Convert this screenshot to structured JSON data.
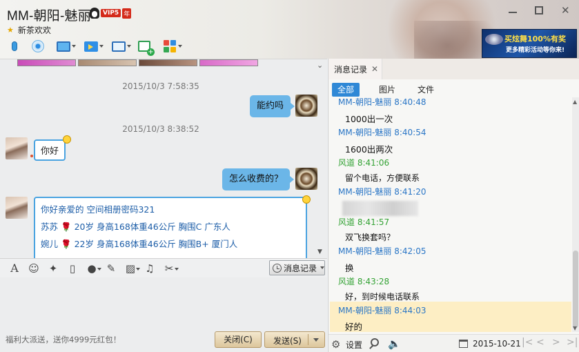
{
  "window": {
    "title": "MM-朝阳-魅丽",
    "vip_label": "VIP5",
    "vip_year_label": "年",
    "signature": "新茶欢欢"
  },
  "ad": {
    "line1": "买炫舞100%有奖",
    "line2": "更多精彩活动等你来!"
  },
  "toolbar_icons": [
    "microphone-icon",
    "video-call-icon",
    "screen-share-icon",
    "file-transfer-icon",
    "remote-assist-icon",
    "add-note-icon",
    "apps-icon"
  ],
  "chat": {
    "messages": [
      {
        "type": "time",
        "text": "2015/10/3 7:58:35"
      },
      {
        "type": "self",
        "text": "能约吗"
      },
      {
        "type": "time",
        "text": "2015/10/3 8:38:52"
      },
      {
        "type": "other",
        "text": "你好"
      },
      {
        "type": "self",
        "text": "怎么收费的？"
      }
    ],
    "long_message": {
      "line1": "你好亲爱的  空间相册密码321",
      "line2_name": "苏苏",
      "line2_rest": "20岁 身高168体重46公斤 胸围C  广东人",
      "line3_name": "婉儿",
      "line3_rest": "22岁 身高168体重46公斤 胸围B+  厦门人"
    }
  },
  "input_toolbar": {
    "history_button": "消息记录"
  },
  "bottom": {
    "promo": "福利大派送，送你4999元红包！",
    "close_button": "关闭(C)",
    "send_button": "发送(S)"
  },
  "history": {
    "tab_label": "消息记录",
    "filters": [
      "全部",
      "图片",
      "文件"
    ],
    "records": [
      {
        "who": "MM-朝阳-魅丽",
        "time": "8:40:48",
        "self": false
      },
      {
        "text": "1000出一次"
      },
      {
        "who": "MM-朝阳-魅丽",
        "time": "8:40:54",
        "self": false
      },
      {
        "text": "1600出两次"
      },
      {
        "who": "风道",
        "time": "8:41:06",
        "self": true
      },
      {
        "text": "留个电话，方便联系"
      },
      {
        "who": "MM-朝阳-魅丽",
        "time": "8:41:20",
        "self": false
      },
      {
        "who": "风道",
        "time": "8:41:57",
        "self": true
      },
      {
        "text": "双飞换套吗？"
      },
      {
        "who": "MM-朝阳-魅丽",
        "time": "8:42:05",
        "self": false
      },
      {
        "text": "换"
      },
      {
        "who": "风道",
        "time": "8:43:28",
        "self": true
      },
      {
        "text": "好，到时候电话联系"
      },
      {
        "who": "MM-朝阳-魅丽",
        "time": "8:44:03",
        "self": false
      },
      {
        "text": "好的"
      }
    ],
    "footer": {
      "settings_label": "设置",
      "date": "2015-10-21"
    }
  },
  "colors": {
    "accent_blue": "#2f88d6",
    "name_other": "#2a76c6",
    "name_self": "#33a234",
    "self_bubble": "#6bb6e8",
    "highlight_row": "#fdeec4"
  }
}
